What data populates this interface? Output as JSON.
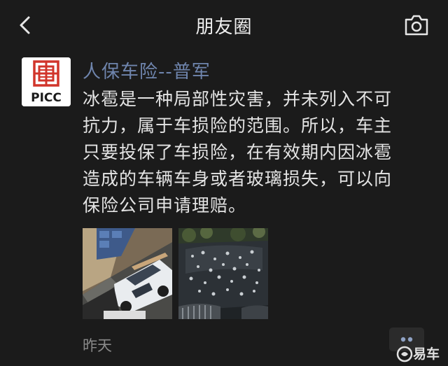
{
  "header": {
    "title": "朋友圈",
    "back_icon": "back-chevron-icon",
    "camera_icon": "camera-icon"
  },
  "post": {
    "avatar_brand": "PICC",
    "author": "人保车险--普军",
    "text_lines": [
      "冰雹是一种局部性灾害，并未列入不可",
      "抗力，属于车损险的范围。所以，车主",
      "只要投保了车损险，在有效期内因冰雹",
      "造成的车辆车身或者玻璃损失，可以向",
      "保险公司申请理赔。"
    ],
    "time": "昨天"
  },
  "watermark": {
    "text": "易车"
  },
  "colors": {
    "background": "#1b1b1b",
    "author_link": "#6f85ad",
    "picc_red": "#d1352b"
  }
}
